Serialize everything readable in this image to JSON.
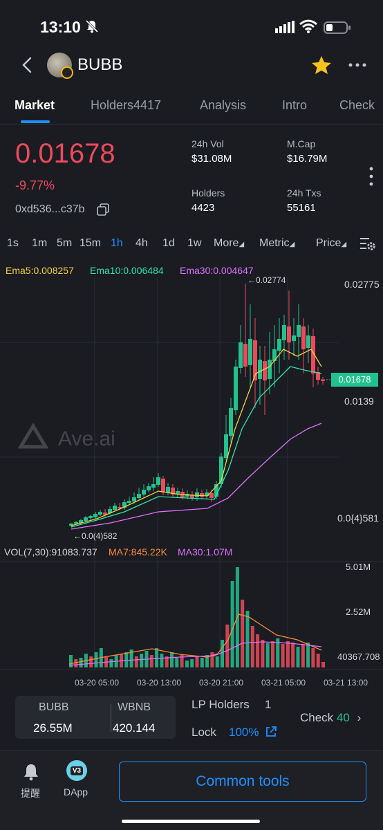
{
  "status": {
    "time": "13:10"
  },
  "header": {
    "token": "BUBB"
  },
  "tabs": [
    "Market",
    "Holders4417",
    "Analysis",
    "Intro",
    "Check"
  ],
  "summary": {
    "price": "0.01678",
    "change": "-9.77%",
    "address": "0xd536...c37b",
    "vol_label": "24h Vol",
    "vol": "$31.08M",
    "mcap_label": "M.Cap",
    "mcap": "$16.79M",
    "holders_label": "Holders",
    "holders": "4423",
    "txs_label": "24h Txs",
    "txs": "55161"
  },
  "timeframes": [
    "1s",
    "1m",
    "5m",
    "15m",
    "1h",
    "4h",
    "1d",
    "1w"
  ],
  "selected_timeframe": "1h",
  "dropdowns": [
    "More",
    "Metric",
    "Price"
  ],
  "legend": {
    "ema5": "Ema5:0.008257",
    "ema10": "Ema10:0.006484",
    "ema30": "Ema30:0.004647",
    "vol": "VOL(7,30):91083.737",
    "ma7": "MA7:845.22K",
    "ma30": "MA30:1.07M"
  },
  "chart_labels": {
    "high_marker": "←0.02774",
    "low_marker": "←0.0(4)582",
    "axis_top": "0.02775",
    "axis_current": "0.01678",
    "axis_mid": "0.0139",
    "axis_low": "0.0{4}581",
    "vol_axis": [
      "5.01M",
      "2.52M",
      "40367.708"
    ],
    "x_ticks": [
      "03-20 05:00",
      "03-20 13:00",
      "03-20 21:00",
      "03-21 05:00",
      "03-21 13:00"
    ],
    "watermark": "Ave.ai"
  },
  "colors": {
    "up": "#21c28e",
    "down": "#ee4a5c",
    "ema5": "#f4d03f",
    "ema10": "#2ee6a8",
    "ema30": "#e070ff",
    "ma7": "#ff8c3a",
    "ma30": "#e070ff",
    "accent": "#1f8fff"
  },
  "pool": {
    "a_label": "BUBB",
    "a_value": "26.55M",
    "b_label": "WBNB",
    "b_value": "420.144"
  },
  "lp": {
    "holders_label": "LP Holders",
    "holders_value": "1",
    "lock_label": "Lock",
    "lock_value": "100%"
  },
  "check": {
    "label": "Check",
    "value": "40"
  },
  "nav": {
    "alerts": "提醒",
    "dapp": "DApp",
    "dapp_badge": "V3",
    "common_tools": "Common tools"
  }
}
